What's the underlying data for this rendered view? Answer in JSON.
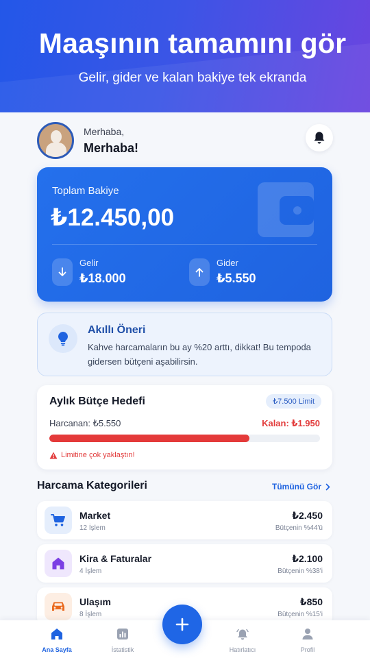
{
  "hero": {
    "title": "Maaşının tamamını gör",
    "subtitle": "Gelir, gider ve kalan bakiye tek ekranda"
  },
  "header": {
    "greeting_small": "Merhaba,",
    "greeting_name": "Merhaba!",
    "notification_icon": "bell-icon"
  },
  "balance": {
    "label": "Toplam Bakiye",
    "amount": "₺12.450,00",
    "income": {
      "label": "Gelir",
      "value": "₺18.000",
      "icon": "arrow-down-icon"
    },
    "expense": {
      "label": "Gider",
      "value": "₺5.550",
      "icon": "arrow-up-icon"
    }
  },
  "tip": {
    "title": "Akıllı Öneri",
    "body": "Kahve harcamaların bu ay %20 arttı, dikkat! Bu tempoda gidersen bütçeni aşabilirsin.",
    "icon": "lightbulb-icon"
  },
  "budget": {
    "title": "Aylık Bütçe Hedefi",
    "limit": "₺7.500 Limit",
    "spent": "Harcanan: ₺5.550",
    "remaining": "Kalan: ₺1.950",
    "progress": 0.74,
    "warning": "Limitine çok yaklaştın!"
  },
  "categories": {
    "title": "Harcama Kategorileri",
    "see_all": "Tümünü Gör",
    "items": [
      {
        "name": "Market",
        "count": "12 İşlem",
        "amount": "₺2.450",
        "percent": "Bütçenin %44'ü",
        "icon": "cart-icon",
        "color": "#1f63e0",
        "bg": "#e5eefc"
      },
      {
        "name": "Kira & Faturalar",
        "count": "4 İşlem",
        "amount": "₺2.100",
        "percent": "Bütçenin %38'i",
        "icon": "home-icon",
        "color": "#7b3fe4",
        "bg": "#efe7fd"
      },
      {
        "name": "Ulaşım",
        "count": "8 İşlem",
        "amount": "₺850",
        "percent": "Bütçenin %15'i",
        "icon": "car-icon",
        "color": "#ea6a1f",
        "bg": "#fdeee3"
      }
    ]
  },
  "nav": {
    "home": "Ana Sayfa",
    "stats": "İstatistik",
    "reminders": "Hatırlatıcı",
    "profile": "Profil",
    "active": "home"
  },
  "colors": {
    "accent": "#1f63e0",
    "danger": "#e43a3a"
  }
}
